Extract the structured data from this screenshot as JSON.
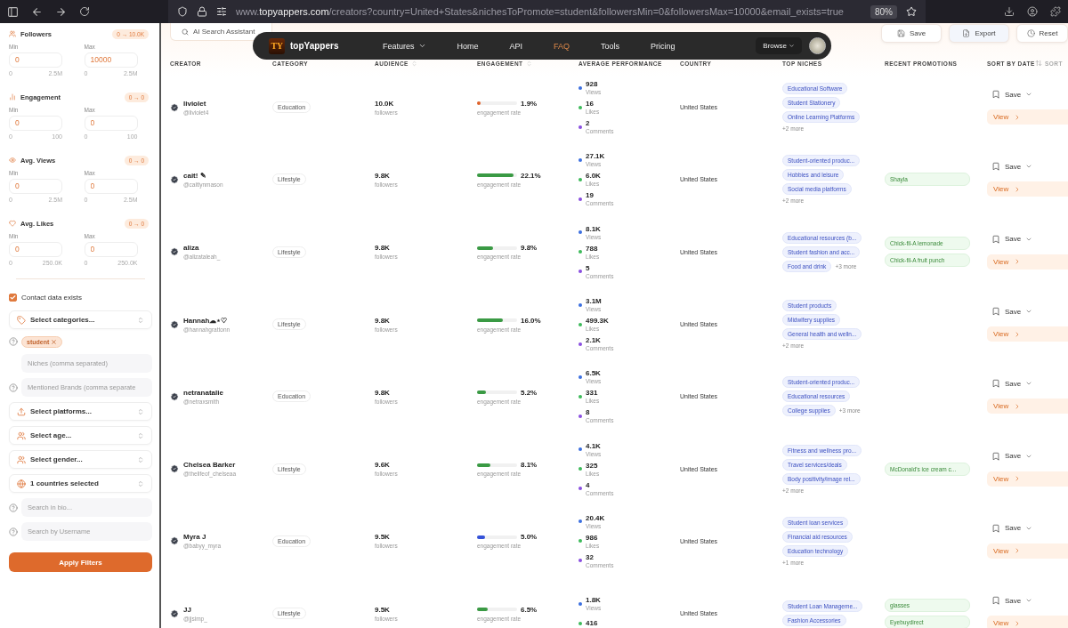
{
  "browser": {
    "url": "www.**topyappers.com**/creators?country=United+States&nichesToPromote=student&followersMin=0&followersMax=10000&email_exists=true",
    "zoom": "80%"
  },
  "sidebar": {
    "ranges": [
      {
        "kind": "users",
        "label": "Followers",
        "badge": "0 → 10.0K",
        "min_label": "Min",
        "max_label": "Max",
        "min_value": "0",
        "max_value": "10000",
        "min_hint": [
          "0",
          "2.5M"
        ],
        "max_hint": [
          "0",
          "2.5M"
        ]
      },
      {
        "kind": "bars",
        "label": "Engagement",
        "badge": "0 → 0",
        "min_label": "Min",
        "max_label": "Max",
        "min_value": "0",
        "max_value": "0",
        "min_hint": [
          "0",
          "100"
        ],
        "max_hint": [
          "0",
          "100"
        ]
      },
      {
        "kind": "eye",
        "label": "Avg. Views",
        "badge": "0 → 0",
        "min_label": "Min",
        "max_label": "Max",
        "min_value": "0",
        "max_value": "0",
        "min_hint": [
          "0",
          "2.5M"
        ],
        "max_hint": [
          "0",
          "2.5M"
        ]
      },
      {
        "kind": "heart",
        "label": "Avg. Likes",
        "badge": "0 → 0",
        "min_label": "Min",
        "max_label": "Max",
        "min_value": "0",
        "max_value": "0",
        "min_hint": [
          "0",
          "250.0K"
        ],
        "max_hint": [
          "0",
          "250.0K"
        ]
      }
    ],
    "contact": {
      "label": "Contact data exists",
      "checked": true
    },
    "controls": [
      {
        "kind": "categories",
        "label": "Select categories...",
        "help": false
      },
      {
        "kind": "chips",
        "chips": [
          "student"
        ],
        "help": true
      },
      {
        "kind": "input",
        "placeholder": "Niches (comma separated)",
        "help": false
      },
      {
        "kind": "input",
        "placeholder": "Mentioned Brands (comma separate",
        "help": true
      },
      {
        "kind": "platforms",
        "label": "Select platforms...",
        "help": false
      },
      {
        "kind": "age",
        "label": "Select age...",
        "help": false
      },
      {
        "kind": "gender",
        "label": "Select gender...",
        "help": false
      },
      {
        "kind": "countries",
        "label": "1 countries selected",
        "help": false
      },
      {
        "kind": "input",
        "placeholder": "Search in bio...",
        "help": true
      },
      {
        "kind": "input",
        "placeholder": "Search by Username",
        "help": true
      }
    ],
    "apply": "Apply Filters"
  },
  "toolbar": {
    "ai_search": "AI Search Assistant",
    "actions": [
      {
        "kind": "save",
        "label": "Save"
      },
      {
        "kind": "export",
        "label": "Export"
      },
      {
        "kind": "reset",
        "label": "Reset"
      }
    ]
  },
  "nav": {
    "brand": "topYappers",
    "logo": "TY",
    "items": [
      {
        "label": "Features",
        "dropdown": true,
        "selected": false
      },
      {
        "label": "Home",
        "dropdown": false,
        "selected": false
      },
      {
        "label": "API",
        "dropdown": false,
        "selected": false
      },
      {
        "label": "FAQ",
        "dropdown": false,
        "selected": true
      },
      {
        "label": "Tools",
        "dropdown": false,
        "selected": false
      },
      {
        "label": "Pricing",
        "dropdown": false,
        "selected": false
      }
    ],
    "browse": "Browse"
  },
  "table": {
    "columns": [
      {
        "label": "CREATOR",
        "sortable": false
      },
      {
        "label": "CATEGORY",
        "sortable": false
      },
      {
        "label": "AUDIENCE",
        "sortable": true
      },
      {
        "label": "ENGAGEMENT",
        "sortable": true
      },
      {
        "label": "AVERAGE PERFORMANCE",
        "sortable": false
      },
      {
        "label": "COUNTRY",
        "sortable": false
      },
      {
        "label": "TOP NICHES",
        "sortable": false
      },
      {
        "label": "RECENT PROMOTIONS",
        "sortable": false
      },
      {
        "label": "SORT BY DATE",
        "sortable": false
      }
    ],
    "sort": "SORT",
    "rows": [
      {
        "name": "liviolet",
        "handle": "@liviolet4",
        "category": "Education",
        "audience": "10.0K",
        "audience_label": "followers",
        "engagement": "1.9%",
        "engagement_label": "engagement rate",
        "level": 0.08,
        "color": "#e0622a",
        "metrics": [
          {
            "value": "928",
            "label": "Views",
            "color": "#3b6fe0"
          },
          {
            "value": "16",
            "label": "Likes",
            "color": "#3dba5a"
          },
          {
            "value": "2",
            "label": "Comments",
            "color": "#8a4fe0"
          }
        ],
        "country": "United States",
        "niches": [
          "Educational Software",
          "Student Stationery",
          "Online Learning Platforms"
        ],
        "more": "+2 more",
        "more_inline": false,
        "promotions": [],
        "save": "Save",
        "view": "View"
      },
      {
        "name": "cait! ✎",
        "handle": "@caitlynmason",
        "category": "Lifestyle",
        "audience": "9.8K",
        "audience_label": "followers",
        "engagement": "22.1%",
        "engagement_label": "engagement rate",
        "level": 0.9,
        "color": "#3a9a44",
        "metrics": [
          {
            "value": "27.1K",
            "label": "Views",
            "color": "#3b6fe0"
          },
          {
            "value": "6.0K",
            "label": "Likes",
            "color": "#3dba5a"
          },
          {
            "value": "19",
            "label": "Comments",
            "color": "#8a4fe0"
          }
        ],
        "country": "United States",
        "niches": [
          "Student-oriented produc...",
          "Hobbies and leisure",
          "Social media platforms"
        ],
        "more": "+2 more",
        "more_inline": false,
        "promotions": [
          "Shayla"
        ],
        "save": "Save",
        "view": "View"
      },
      {
        "name": "aliza",
        "handle": "@alizataleah_",
        "category": "Lifestyle",
        "audience": "9.8K",
        "audience_label": "followers",
        "engagement": "9.8%",
        "engagement_label": "engagement rate",
        "level": 0.4,
        "color": "#3a9a44",
        "metrics": [
          {
            "value": "8.1K",
            "label": "Views",
            "color": "#3b6fe0"
          },
          {
            "value": "788",
            "label": "Likes",
            "color": "#3dba5a"
          },
          {
            "value": "5",
            "label": "Comments",
            "color": "#8a4fe0"
          }
        ],
        "country": "United States",
        "niches": [
          "Educational resources (b...",
          "Student fashion and acc...",
          "Food and drink"
        ],
        "more": "+3 more",
        "more_inline": true,
        "promotions": [
          "Chick-fil-A lemonade",
          "Chick-fil-A fruit punch"
        ],
        "save": "Save",
        "view": "View"
      },
      {
        "name": "Hannah☁⋆♡",
        "handle": "@hannahgrattonn",
        "category": "Lifestyle",
        "audience": "9.8K",
        "audience_label": "followers",
        "engagement": "16.0%",
        "engagement_label": "engagement rate",
        "level": 0.65,
        "color": "#3a9a44",
        "metrics": [
          {
            "value": "3.1M",
            "label": "Views",
            "color": "#3b6fe0"
          },
          {
            "value": "499.3K",
            "label": "Likes",
            "color": "#3dba5a"
          },
          {
            "value": "2.1K",
            "label": "Comments",
            "color": "#8a4fe0"
          }
        ],
        "country": "United States",
        "niches": [
          "Student products",
          "Midwifery supplies",
          "General health and welln..."
        ],
        "more": "+2 more",
        "more_inline": false,
        "promotions": [],
        "save": "Save",
        "view": "View"
      },
      {
        "name": "netranatalie",
        "handle": "@netraxsmith",
        "category": "Education",
        "audience": "9.8K",
        "audience_label": "followers",
        "engagement": "5.2%",
        "engagement_label": "engagement rate",
        "level": 0.22,
        "color": "#3a9a44",
        "metrics": [
          {
            "value": "6.5K",
            "label": "Views",
            "color": "#3b6fe0"
          },
          {
            "value": "331",
            "label": "Likes",
            "color": "#3dba5a"
          },
          {
            "value": "8",
            "label": "Comments",
            "color": "#8a4fe0"
          }
        ],
        "country": "United States",
        "niches": [
          "Student-oriented produc...",
          "Educational resources",
          "College supplies"
        ],
        "more": "+3 more",
        "more_inline": true,
        "promotions": [],
        "save": "Save",
        "view": "View"
      },
      {
        "name": "Chelsea Barker",
        "handle": "@thelifeof_chelseaa",
        "category": "Lifestyle",
        "audience": "9.6K",
        "audience_label": "followers",
        "engagement": "8.1%",
        "engagement_label": "engagement rate",
        "level": 0.33,
        "color": "#3a9a44",
        "metrics": [
          {
            "value": "4.1K",
            "label": "Views",
            "color": "#3b6fe0"
          },
          {
            "value": "325",
            "label": "Likes",
            "color": "#3dba5a"
          },
          {
            "value": "4",
            "label": "Comments",
            "color": "#8a4fe0"
          }
        ],
        "country": "United States",
        "niches": [
          "Fitness and wellness pro...",
          "Travel services/deals",
          "Body positivity/image rel..."
        ],
        "more": "+2 more",
        "more_inline": false,
        "promotions": [
          "McDonald's ice cream c..."
        ],
        "save": "Save",
        "view": "View"
      },
      {
        "name": "Myra J",
        "handle": "@babyy_myra",
        "category": "Education",
        "audience": "9.5K",
        "audience_label": "followers",
        "engagement": "5.0%",
        "engagement_label": "engagement rate",
        "level": 0.2,
        "color": "#3552d8",
        "metrics": [
          {
            "value": "20.4K",
            "label": "Views",
            "color": "#3b6fe0"
          },
          {
            "value": "986",
            "label": "Likes",
            "color": "#3dba5a"
          },
          {
            "value": "32",
            "label": "Comments",
            "color": "#8a4fe0"
          }
        ],
        "country": "United States",
        "niches": [
          "Student loan services",
          "Financial aid resources",
          "Education technology"
        ],
        "more": "+1 more",
        "more_inline": false,
        "promotions": [],
        "save": "Save",
        "view": "View"
      },
      {
        "name": "JJ",
        "handle": "@jjsimp_",
        "category": "Lifestyle",
        "audience": "9.5K",
        "audience_label": "followers",
        "engagement": "6.5%",
        "engagement_label": "engagement rate",
        "level": 0.26,
        "color": "#3a9a44",
        "metrics": [
          {
            "value": "1.8K",
            "label": "Views",
            "color": "#3b6fe0"
          },
          {
            "value": "416",
            "color": "#3dba5a"
          }
        ],
        "country": "United States",
        "niches": [
          "Student Loan Manageme...",
          "Fashion Accessories"
        ],
        "promotions": [
          "glasses",
          "Eyebuydirect"
        ],
        "save": "Save",
        "view": "View"
      }
    ]
  }
}
